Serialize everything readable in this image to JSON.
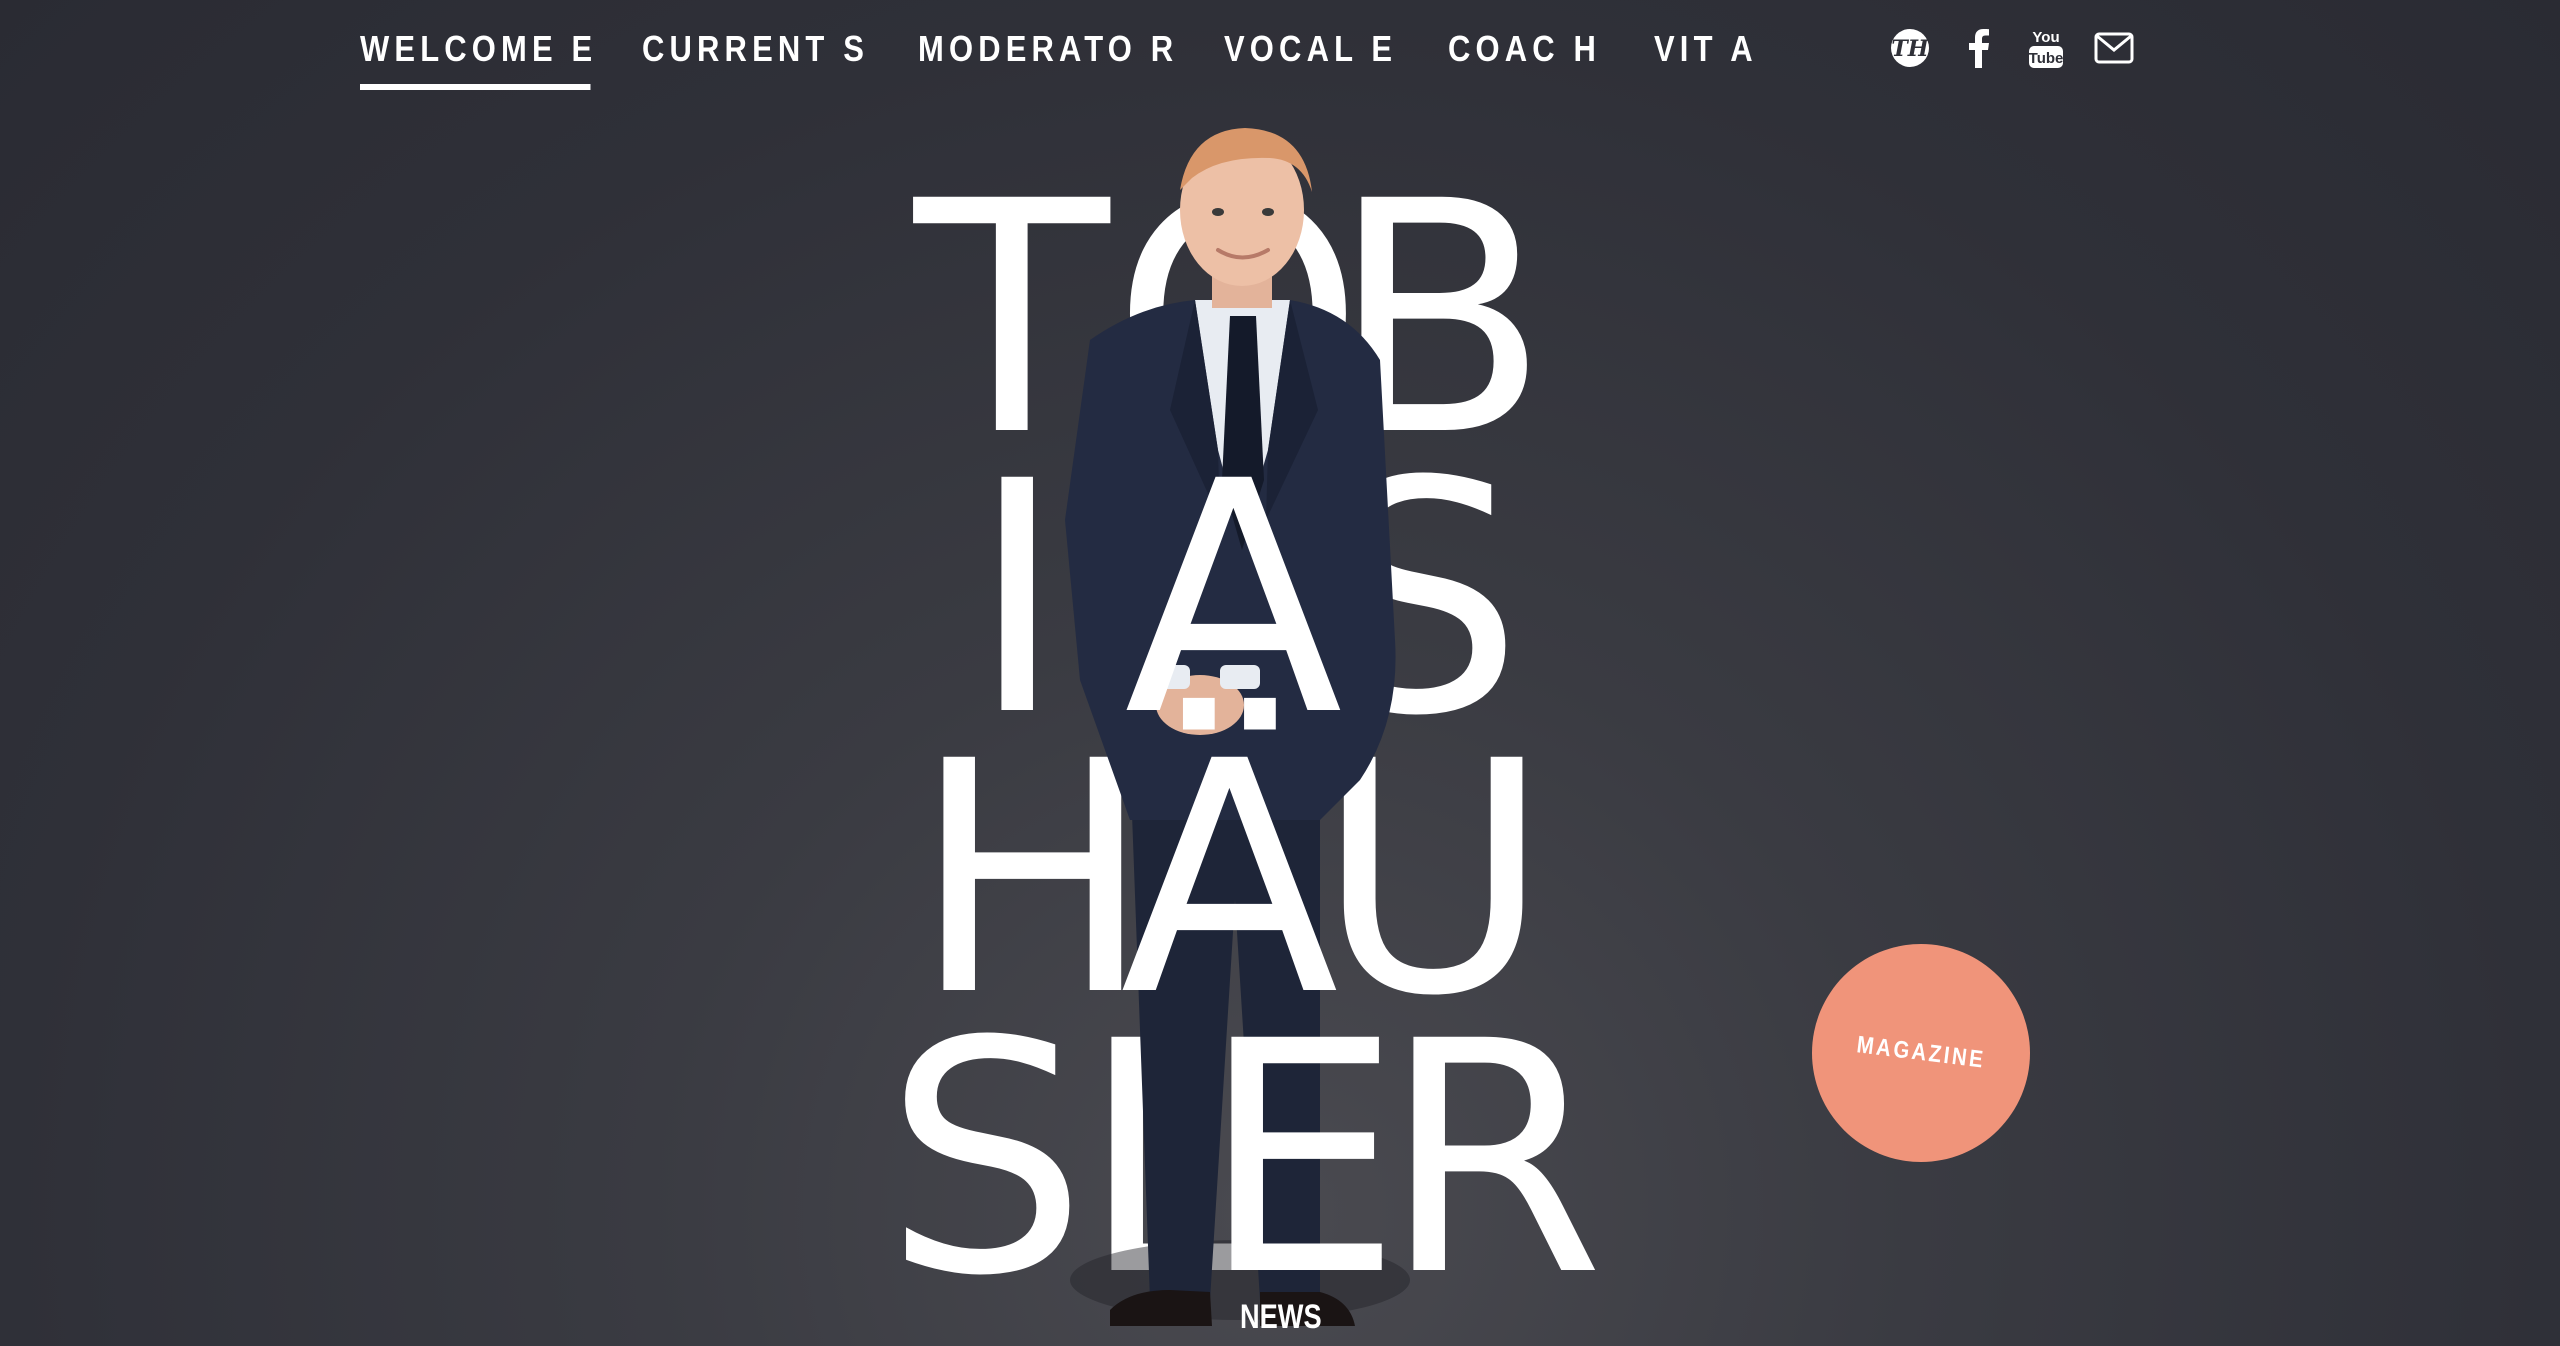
{
  "nav": {
    "items": [
      {
        "label": "WELCOME E",
        "active": true
      },
      {
        "label": "CURRENT S",
        "active": false
      },
      {
        "label": "MODERATO R",
        "active": false
      },
      {
        "label": "VOCAL E",
        "active": false
      },
      {
        "label": "COAC H",
        "active": false
      },
      {
        "label": "VIT A",
        "active": false
      }
    ],
    "social": [
      {
        "icon": "th-logo-icon"
      },
      {
        "icon": "facebook-icon"
      },
      {
        "icon": "youtube-icon",
        "top": "You",
        "bottom": "Tube"
      },
      {
        "icon": "mail-icon"
      }
    ]
  },
  "hero": {
    "letters": [
      "T",
      "O",
      "B",
      "I",
      "A",
      "S",
      "H",
      "Ä",
      "U",
      "S",
      "L",
      "E",
      "R"
    ]
  },
  "magazine_label": "MAGAZINE",
  "news_label": "NEWS",
  "colors": {
    "background": "#2f3038",
    "accent": "#f0947a",
    "text": "#ffffff",
    "suit": "#1f2740"
  }
}
